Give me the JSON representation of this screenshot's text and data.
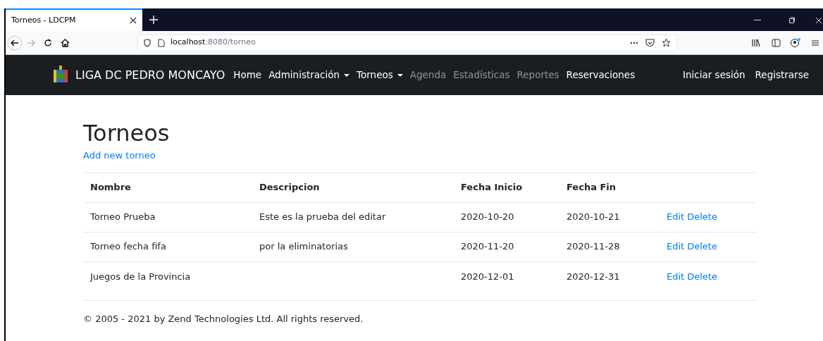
{
  "browser": {
    "tab_title": "Torneos - LDCPM",
    "url_host": "localhost",
    "url_path": ":8080/torneo"
  },
  "navbar": {
    "brand": "LIGA DC PEDRO MONCAYO",
    "items": [
      {
        "label": "Home",
        "dropdown": false,
        "disabled": false
      },
      {
        "label": "Administración",
        "dropdown": true,
        "disabled": false
      },
      {
        "label": "Torneos",
        "dropdown": true,
        "disabled": false
      },
      {
        "label": "Agenda",
        "dropdown": false,
        "disabled": true
      },
      {
        "label": "Estadísticas",
        "dropdown": false,
        "disabled": true
      },
      {
        "label": "Reportes",
        "dropdown": false,
        "disabled": true
      },
      {
        "label": "Reservaciones",
        "dropdown": false,
        "disabled": false
      }
    ],
    "right_items": [
      "Iniciar sesión",
      "Registrarse"
    ]
  },
  "page": {
    "title": "Torneos",
    "add_link": "Add new torneo"
  },
  "table": {
    "columns": [
      "Nombre",
      "Descripcion",
      "Fecha Inicio",
      "Fecha Fin"
    ],
    "rows": [
      {
        "cells": [
          "Torneo Prueba",
          "Este es la prueba del editar",
          "2020-10-20",
          "2020-10-21"
        ],
        "actions": [
          "Edit",
          "Delete"
        ]
      },
      {
        "cells": [
          "Torneo fecha fifa",
          "por la eliminatorias",
          "2020-11-20",
          "2020-11-28"
        ],
        "actions": [
          "Edit",
          "Delete"
        ]
      },
      {
        "cells": [
          "Juegos de la Provincia",
          "",
          "2020-12-01",
          "2020-12-31"
        ],
        "actions": [
          "Edit",
          "Delete"
        ]
      }
    ]
  },
  "footer": "© 2005 - 2021 by Zend Technologies Ltd. All rights reserved."
}
